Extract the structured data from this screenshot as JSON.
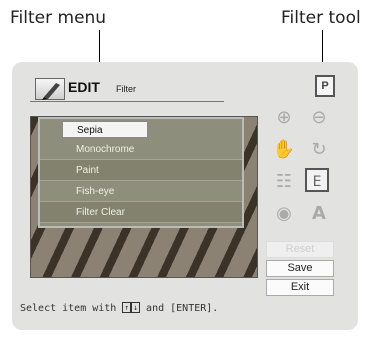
{
  "callouts": {
    "left": "Filter menu",
    "right": "Filter tool"
  },
  "header": {
    "title": "EDIT",
    "subtitle": "Filter",
    "print_icon_label": "P"
  },
  "filter_menu": {
    "items": [
      {
        "label": "Sepia",
        "selected": true
      },
      {
        "label": "Monochrome"
      },
      {
        "label": "Paint"
      },
      {
        "label": "Fish-eye"
      },
      {
        "label": "Filter Clear"
      }
    ]
  },
  "tools": [
    "zoom-in-icon",
    "zoom-out-icon",
    "hand-icon",
    "rotate-icon",
    "adjust-icon",
    "filter-icon",
    "eye-icon",
    "text-icon"
  ],
  "buttons": {
    "reset": "Reset",
    "save": "Save",
    "exit": "Exit"
  },
  "status": {
    "prefix": "Select item with",
    "keys": [
      "↑",
      "↓"
    ],
    "suffix": "and [ENTER]."
  }
}
